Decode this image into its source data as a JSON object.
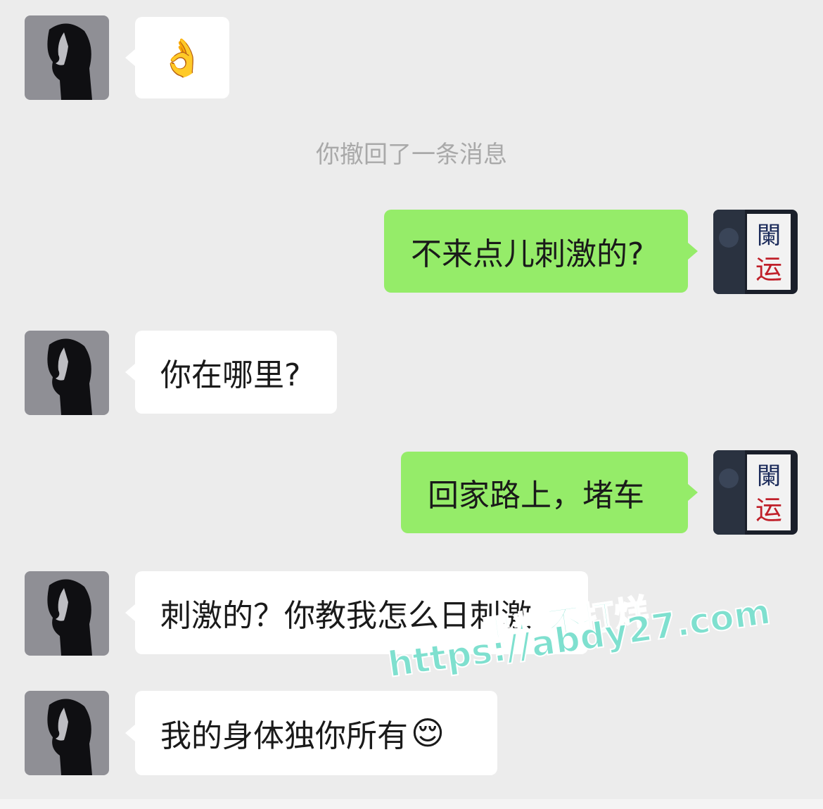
{
  "chat": {
    "system_notice": "你撤回了一条消息",
    "messages": [
      {
        "side": "left",
        "text": "👌"
      },
      {
        "side": "right",
        "text": "不来点儿刺激的?"
      },
      {
        "side": "left",
        "text": "你在哪里?"
      },
      {
        "side": "right",
        "text": "回家路上，堵车"
      },
      {
        "side": "left",
        "text": "刺激的？你教我怎么日刺激"
      },
      {
        "side": "left",
        "text": "我的身体独你所有",
        "emoji": "😌"
      }
    ]
  },
  "self_avatar": {
    "line1": "闌",
    "line2": "运"
  },
  "watermark": {
    "line1": "黑料不打烊",
    "line2": "https://abdy27.com"
  },
  "colors": {
    "background": "#ececec",
    "self_bubble": "#95ec69",
    "other_bubble": "#ffffff",
    "watermark": "#7fe0cf"
  }
}
